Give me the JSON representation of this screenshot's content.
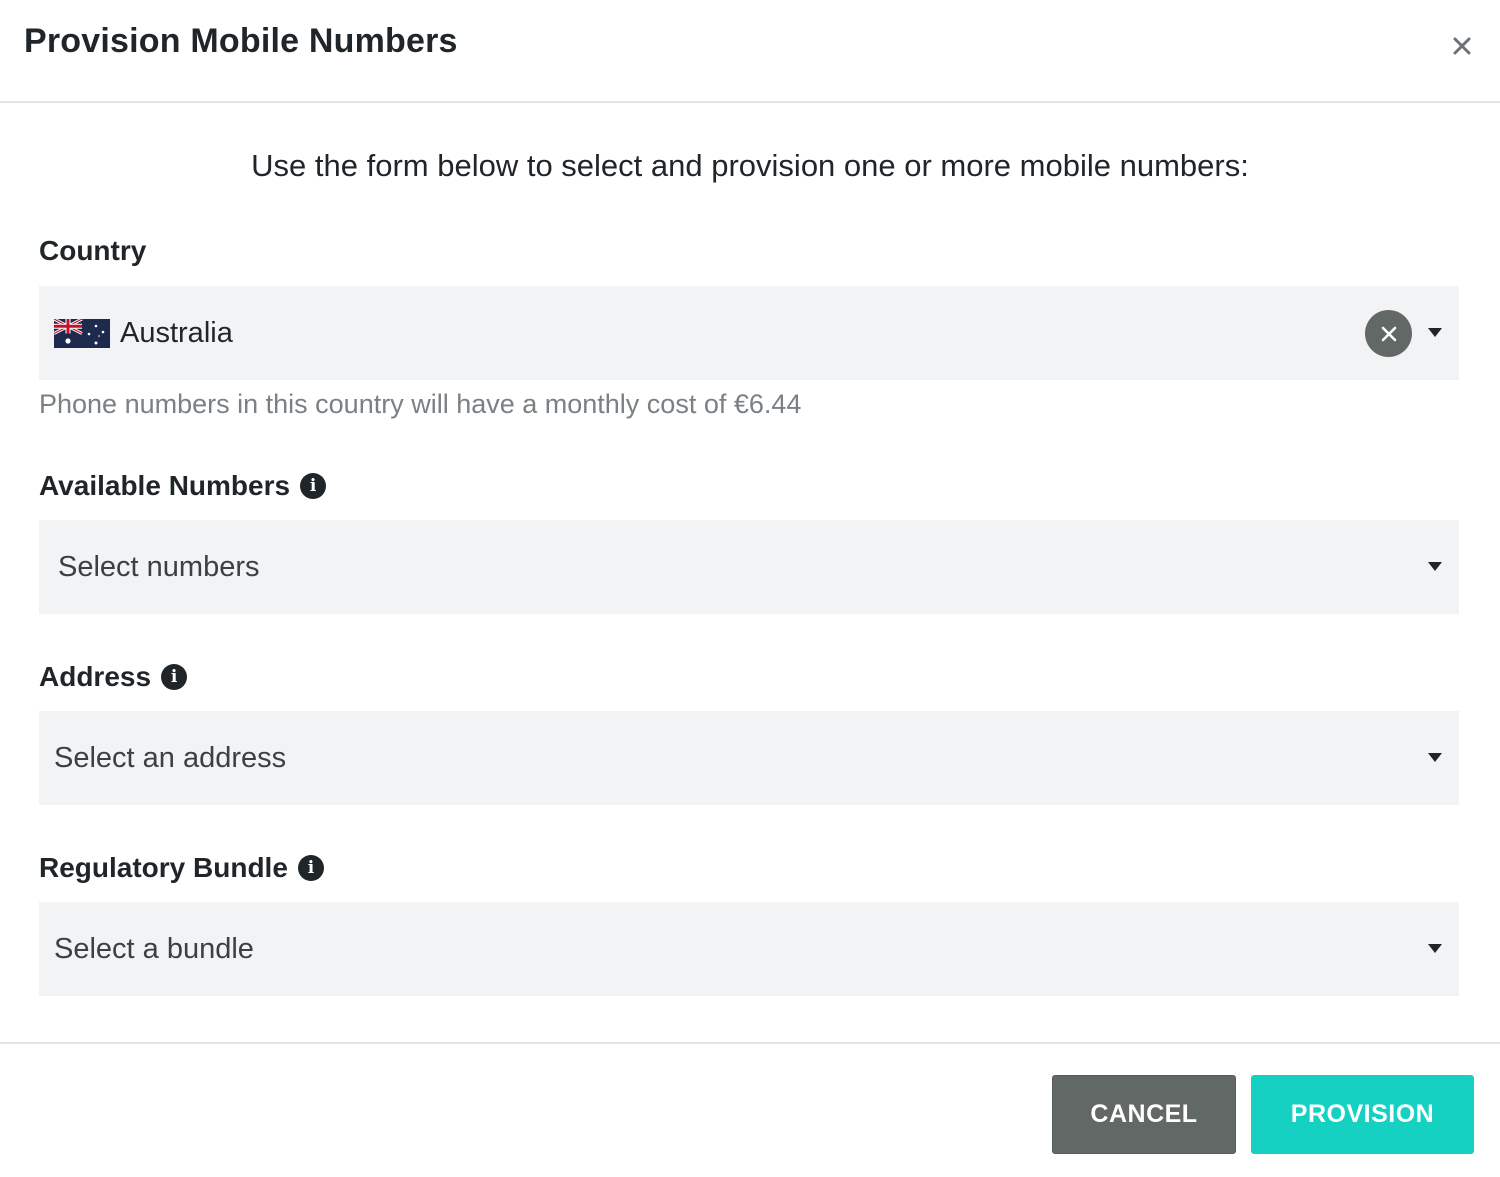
{
  "dialog": {
    "title": "Provision Mobile Numbers",
    "close_icon": "close-icon",
    "intro": "Use the form below to select and provision one or more mobile numbers:"
  },
  "country": {
    "label": "Country",
    "value": "Australia",
    "flag_icon": "australia-flag-icon",
    "clear_icon": "clear-icon",
    "hint": "Phone numbers in this country will have a monthly cost of €6.44"
  },
  "numbers": {
    "label": "Available Numbers",
    "placeholder": "Select numbers",
    "info_icon": "info-icon"
  },
  "address": {
    "label": "Address",
    "placeholder": "Select an address",
    "info_icon": "info-icon"
  },
  "bundle": {
    "label": "Regulatory Bundle",
    "placeholder": "Select a bundle",
    "info_icon": "info-icon"
  },
  "footer": {
    "cancel_label": "CANCEL",
    "provision_label": "PROVISION"
  },
  "colors": {
    "primary": "#15d1c2",
    "secondary": "#616866",
    "field_bg": "#f2f3f5",
    "text": "#1f2528",
    "muted": "#7a8084"
  }
}
